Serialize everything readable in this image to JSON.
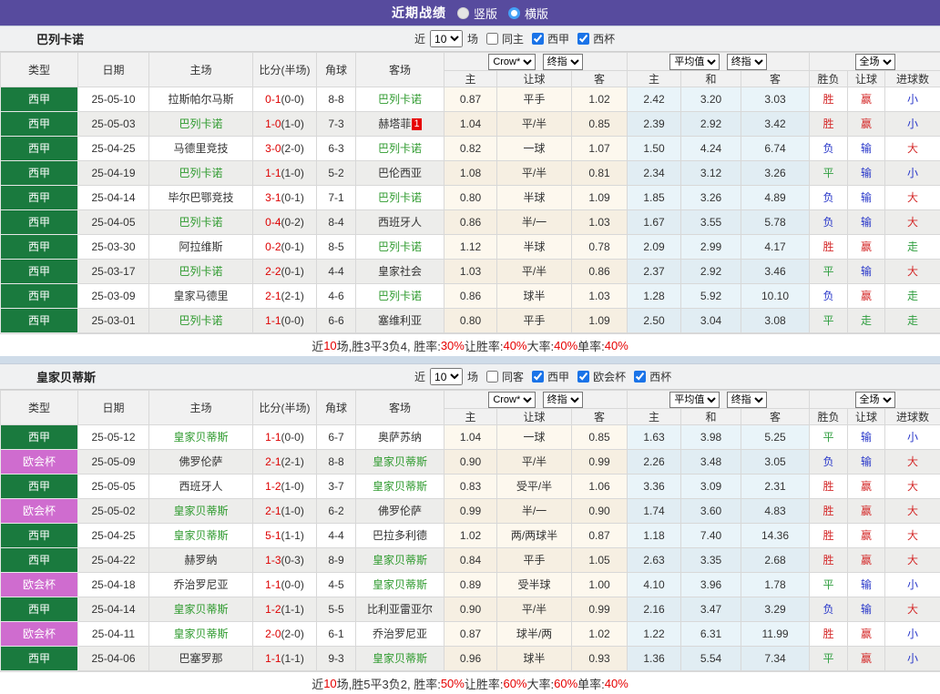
{
  "topbar": {
    "title": "近期战绩",
    "radios": [
      {
        "label": "竖版",
        "selected": false
      },
      {
        "label": "横版",
        "selected": true
      }
    ]
  },
  "columns": {
    "type": "类型",
    "date": "日期",
    "home": "主场",
    "score": "比分(半场)",
    "corner": "角球",
    "away": "客场",
    "odds_home": "主",
    "odds_handicap": "让球",
    "odds_away": "客",
    "avg_home": "主",
    "avg_draw": "和",
    "avg_away": "客",
    "res_outcome": "胜负",
    "res_handicap": "让球",
    "res_goals": "进球数"
  },
  "selects": {
    "bookmaker": "Crow*",
    "final_odds": "终指",
    "average": "平均值",
    "scope": "全场"
  },
  "filters": {
    "near": "近",
    "count": "10",
    "matches": "场"
  },
  "league_colors": {
    "西甲": "#1a7a3e",
    "欧会杯": "#cf6ccf"
  },
  "result_colors": {
    "胜": "#d42a2a",
    "赢": "#d42a2a",
    "大": "#d42a2a",
    "负": "#2736c9",
    "输": "#2736c9",
    "小": "#2736c9",
    "平": "#2f9e3f",
    "走": "#2f9e3f"
  },
  "sections": [
    {
      "team": "巴列卡诺",
      "same_label": "同主",
      "same_checked": false,
      "leagues": [
        {
          "label": "西甲",
          "checked": true
        },
        {
          "label": "西杯",
          "checked": true
        }
      ],
      "rows": [
        {
          "league": "西甲",
          "date": "25-05-10",
          "home": "拉斯帕尔马斯",
          "home_subject": false,
          "score": "0-1",
          "half": "(0-0)",
          "corner": "8-8",
          "away": "巴列卡诺",
          "away_subject": true,
          "odds": [
            "0.87",
            "平手",
            "1.02"
          ],
          "avg": [
            "2.42",
            "3.20",
            "3.03"
          ],
          "results": [
            "胜",
            "赢",
            "小"
          ]
        },
        {
          "league": "西甲",
          "date": "25-05-03",
          "home": "巴列卡诺",
          "home_subject": true,
          "score": "1-0",
          "half": "(1-0)",
          "corner": "7-3",
          "away": "赫塔菲",
          "away_subject": false,
          "away_badge": "1",
          "odds": [
            "1.04",
            "平/半",
            "0.85"
          ],
          "avg": [
            "2.39",
            "2.92",
            "3.42"
          ],
          "results": [
            "胜",
            "赢",
            "小"
          ]
        },
        {
          "league": "西甲",
          "date": "25-04-25",
          "home": "马德里竞技",
          "home_subject": false,
          "score": "3-0",
          "half": "(2-0)",
          "corner": "6-3",
          "away": "巴列卡诺",
          "away_subject": true,
          "odds": [
            "0.82",
            "一球",
            "1.07"
          ],
          "avg": [
            "1.50",
            "4.24",
            "6.74"
          ],
          "results": [
            "负",
            "输",
            "大"
          ]
        },
        {
          "league": "西甲",
          "date": "25-04-19",
          "home": "巴列卡诺",
          "home_subject": true,
          "score": "1-1",
          "half": "(1-0)",
          "corner": "5-2",
          "away": "巴伦西亚",
          "away_subject": false,
          "odds": [
            "1.08",
            "平/半",
            "0.81"
          ],
          "avg": [
            "2.34",
            "3.12",
            "3.26"
          ],
          "results": [
            "平",
            "输",
            "小"
          ]
        },
        {
          "league": "西甲",
          "date": "25-04-14",
          "home": "毕尔巴鄂竞技",
          "home_subject": false,
          "score": "3-1",
          "half": "(0-1)",
          "corner": "7-1",
          "away": "巴列卡诺",
          "away_subject": true,
          "odds": [
            "0.80",
            "半球",
            "1.09"
          ],
          "avg": [
            "1.85",
            "3.26",
            "4.89"
          ],
          "results": [
            "负",
            "输",
            "大"
          ]
        },
        {
          "league": "西甲",
          "date": "25-04-05",
          "home": "巴列卡诺",
          "home_subject": true,
          "score": "0-4",
          "half": "(0-2)",
          "corner": "8-4",
          "away": "西班牙人",
          "away_subject": false,
          "odds": [
            "0.86",
            "半/一",
            "1.03"
          ],
          "avg": [
            "1.67",
            "3.55",
            "5.78"
          ],
          "results": [
            "负",
            "输",
            "大"
          ]
        },
        {
          "league": "西甲",
          "date": "25-03-30",
          "home": "阿拉维斯",
          "home_subject": false,
          "score": "0-2",
          "half": "(0-1)",
          "corner": "8-5",
          "away": "巴列卡诺",
          "away_subject": true,
          "odds": [
            "1.12",
            "半球",
            "0.78"
          ],
          "avg": [
            "2.09",
            "2.99",
            "4.17"
          ],
          "results": [
            "胜",
            "赢",
            "走"
          ]
        },
        {
          "league": "西甲",
          "date": "25-03-17",
          "home": "巴列卡诺",
          "home_subject": true,
          "score": "2-2",
          "half": "(0-1)",
          "corner": "4-4",
          "away": "皇家社会",
          "away_subject": false,
          "odds": [
            "1.03",
            "平/半",
            "0.86"
          ],
          "avg": [
            "2.37",
            "2.92",
            "3.46"
          ],
          "results": [
            "平",
            "输",
            "大"
          ]
        },
        {
          "league": "西甲",
          "date": "25-03-09",
          "home": "皇家马德里",
          "home_subject": false,
          "score": "2-1",
          "half": "(2-1)",
          "corner": "4-6",
          "away": "巴列卡诺",
          "away_subject": true,
          "odds": [
            "0.86",
            "球半",
            "1.03"
          ],
          "avg": [
            "1.28",
            "5.92",
            "10.10"
          ],
          "results": [
            "负",
            "赢",
            "走"
          ]
        },
        {
          "league": "西甲",
          "date": "25-03-01",
          "home": "巴列卡诺",
          "home_subject": true,
          "score": "1-1",
          "half": "(0-0)",
          "corner": "6-6",
          "away": "塞维利亚",
          "away_subject": false,
          "odds": [
            "0.80",
            "平手",
            "1.09"
          ],
          "avg": [
            "2.50",
            "3.04",
            "3.08"
          ],
          "results": [
            "平",
            "走",
            "走"
          ]
        }
      ],
      "summary": [
        {
          "text": "近"
        },
        {
          "text": "10",
          "red": true
        },
        {
          "text": "场,胜3平3负4, 胜率:"
        },
        {
          "text": "30%",
          "red": true
        },
        {
          "text": " 让胜率:"
        },
        {
          "text": "40%",
          "red": true
        },
        {
          "text": " 大率:"
        },
        {
          "text": "40%",
          "red": true
        },
        {
          "text": " 单率:"
        },
        {
          "text": "40%",
          "red": true
        }
      ]
    },
    {
      "team": "皇家贝蒂斯",
      "same_label": "同客",
      "same_checked": false,
      "leagues": [
        {
          "label": "西甲",
          "checked": true
        },
        {
          "label": "欧会杯",
          "checked": true
        },
        {
          "label": "西杯",
          "checked": true
        }
      ],
      "rows": [
        {
          "league": "西甲",
          "date": "25-05-12",
          "home": "皇家贝蒂斯",
          "home_subject": true,
          "score": "1-1",
          "half": "(0-0)",
          "corner": "6-7",
          "away": "奥萨苏纳",
          "away_subject": false,
          "odds": [
            "1.04",
            "一球",
            "0.85"
          ],
          "avg": [
            "1.63",
            "3.98",
            "5.25"
          ],
          "results": [
            "平",
            "输",
            "小"
          ]
        },
        {
          "league": "欧会杯",
          "date": "25-05-09",
          "home": "佛罗伦萨",
          "home_subject": false,
          "score": "2-1",
          "half": "(2-1)",
          "corner": "8-8",
          "away": "皇家贝蒂斯",
          "away_subject": true,
          "odds": [
            "0.90",
            "平/半",
            "0.99"
          ],
          "avg": [
            "2.26",
            "3.48",
            "3.05"
          ],
          "results": [
            "负",
            "输",
            "大"
          ]
        },
        {
          "league": "西甲",
          "date": "25-05-05",
          "home": "西班牙人",
          "home_subject": false,
          "score": "1-2",
          "half": "(1-0)",
          "corner": "3-7",
          "away": "皇家贝蒂斯",
          "away_subject": true,
          "odds": [
            "0.83",
            "受平/半",
            "1.06"
          ],
          "avg": [
            "3.36",
            "3.09",
            "2.31"
          ],
          "results": [
            "胜",
            "赢",
            "大"
          ]
        },
        {
          "league": "欧会杯",
          "date": "25-05-02",
          "home": "皇家贝蒂斯",
          "home_subject": true,
          "score": "2-1",
          "half": "(1-0)",
          "corner": "6-2",
          "away": "佛罗伦萨",
          "away_subject": false,
          "odds": [
            "0.99",
            "半/一",
            "0.90"
          ],
          "avg": [
            "1.74",
            "3.60",
            "4.83"
          ],
          "results": [
            "胜",
            "赢",
            "大"
          ]
        },
        {
          "league": "西甲",
          "date": "25-04-25",
          "home": "皇家贝蒂斯",
          "home_subject": true,
          "score": "5-1",
          "half": "(1-1)",
          "corner": "4-4",
          "away": "巴拉多利德",
          "away_subject": false,
          "odds": [
            "1.02",
            "两/两球半",
            "0.87"
          ],
          "avg": [
            "1.18",
            "7.40",
            "14.36"
          ],
          "results": [
            "胜",
            "赢",
            "大"
          ]
        },
        {
          "league": "西甲",
          "date": "25-04-22",
          "home": "赫罗纳",
          "home_subject": false,
          "score": "1-3",
          "half": "(0-3)",
          "corner": "8-9",
          "away": "皇家贝蒂斯",
          "away_subject": true,
          "odds": [
            "0.84",
            "平手",
            "1.05"
          ],
          "avg": [
            "2.63",
            "3.35",
            "2.68"
          ],
          "results": [
            "胜",
            "赢",
            "大"
          ]
        },
        {
          "league": "欧会杯",
          "date": "25-04-18",
          "home": "乔治罗尼亚",
          "home_subject": false,
          "score": "1-1",
          "half": "(0-0)",
          "corner": "4-5",
          "away": "皇家贝蒂斯",
          "away_subject": true,
          "odds": [
            "0.89",
            "受半球",
            "1.00"
          ],
          "avg": [
            "4.10",
            "3.96",
            "1.78"
          ],
          "results": [
            "平",
            "输",
            "小"
          ]
        },
        {
          "league": "西甲",
          "date": "25-04-14",
          "home": "皇家贝蒂斯",
          "home_subject": true,
          "score": "1-2",
          "half": "(1-1)",
          "corner": "5-5",
          "away": "比利亚雷亚尔",
          "away_subject": false,
          "odds": [
            "0.90",
            "平/半",
            "0.99"
          ],
          "avg": [
            "2.16",
            "3.47",
            "3.29"
          ],
          "results": [
            "负",
            "输",
            "大"
          ]
        },
        {
          "league": "欧会杯",
          "date": "25-04-11",
          "home": "皇家贝蒂斯",
          "home_subject": true,
          "score": "2-0",
          "half": "(2-0)",
          "corner": "6-1",
          "away": "乔治罗尼亚",
          "away_subject": false,
          "odds": [
            "0.87",
            "球半/两",
            "1.02"
          ],
          "avg": [
            "1.22",
            "6.31",
            "11.99"
          ],
          "results": [
            "胜",
            "赢",
            "小"
          ]
        },
        {
          "league": "西甲",
          "date": "25-04-06",
          "home": "巴塞罗那",
          "home_subject": false,
          "score": "1-1",
          "half": "(1-1)",
          "corner": "9-3",
          "away": "皇家贝蒂斯",
          "away_subject": true,
          "odds": [
            "0.96",
            "球半",
            "0.93"
          ],
          "avg": [
            "1.36",
            "5.54",
            "7.34"
          ],
          "results": [
            "平",
            "赢",
            "小"
          ]
        }
      ],
      "summary": [
        {
          "text": "近"
        },
        {
          "text": "10",
          "red": true
        },
        {
          "text": "场,胜5平3负2, 胜率:"
        },
        {
          "text": "50%",
          "red": true
        },
        {
          "text": " 让胜率:"
        },
        {
          "text": "60%",
          "red": true
        },
        {
          "text": " 大率:"
        },
        {
          "text": "60%",
          "red": true
        },
        {
          "text": " 单率:"
        },
        {
          "text": "40%",
          "red": true
        }
      ]
    }
  ]
}
